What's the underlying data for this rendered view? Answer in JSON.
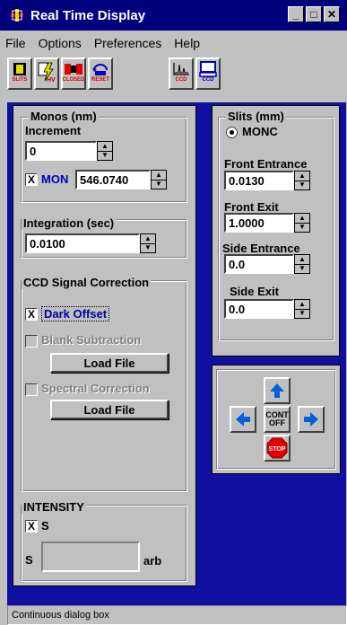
{
  "window": {
    "title": "Real Time Display"
  },
  "window_controls": {
    "minimize": "_",
    "maximize": "□",
    "close": "✕"
  },
  "menu": {
    "file": "File",
    "options": "Options",
    "preferences": "Preferences",
    "help": "Help"
  },
  "toolbar": {
    "slits": "SLITS",
    "hv": "HV",
    "closed": "CLOSED",
    "reset": "RESET",
    "ccd_graph": "CCD",
    "ccd_display": "CCD"
  },
  "monos": {
    "title": "Monos (nm)",
    "increment_label": "Increment",
    "increment_value": "0",
    "mono_label": "MON",
    "mono_checked": "X",
    "mono_value": "546.0740"
  },
  "integration": {
    "title": "Integration (sec)",
    "value": "0.0100"
  },
  "ccd_correction": {
    "title": "CCD Signal Correction",
    "dark_offset_label": "Dark Offset",
    "dark_offset_checked": "X",
    "blank_subtraction_label": "Blank Subtraction",
    "load_file_1": "Load File",
    "spectral_correction_label": "Spectral Correction",
    "load_file_2": "Load File"
  },
  "intensity": {
    "title": "INTENSITY",
    "s_checked": "X",
    "s_check_label": "S",
    "s_label": "S",
    "value": "",
    "unit": "arb"
  },
  "slits": {
    "title": "Slits (mm)",
    "mono_radio_label": "MONC",
    "front_entrance_label": "Front Entrance",
    "front_entrance_value": "0.0130",
    "front_exit_label": "Front Exit",
    "front_exit_value": "1.0000",
    "side_entrance_label": "Side Entrance",
    "side_entrance_value": "0.0",
    "side_exit_label": "Side Exit",
    "side_exit_value": "0.0"
  },
  "control": {
    "cont_line1": "CONT",
    "cont_line2": "OFF",
    "stop": "STOP"
  },
  "status": {
    "text": "Continuous dialog box"
  },
  "colors": {
    "title_bar": "#00007c",
    "main_bg": "#1010a0",
    "panel": "#c0c0c0",
    "arrow": "#0060e0",
    "stop": "#e00000"
  }
}
